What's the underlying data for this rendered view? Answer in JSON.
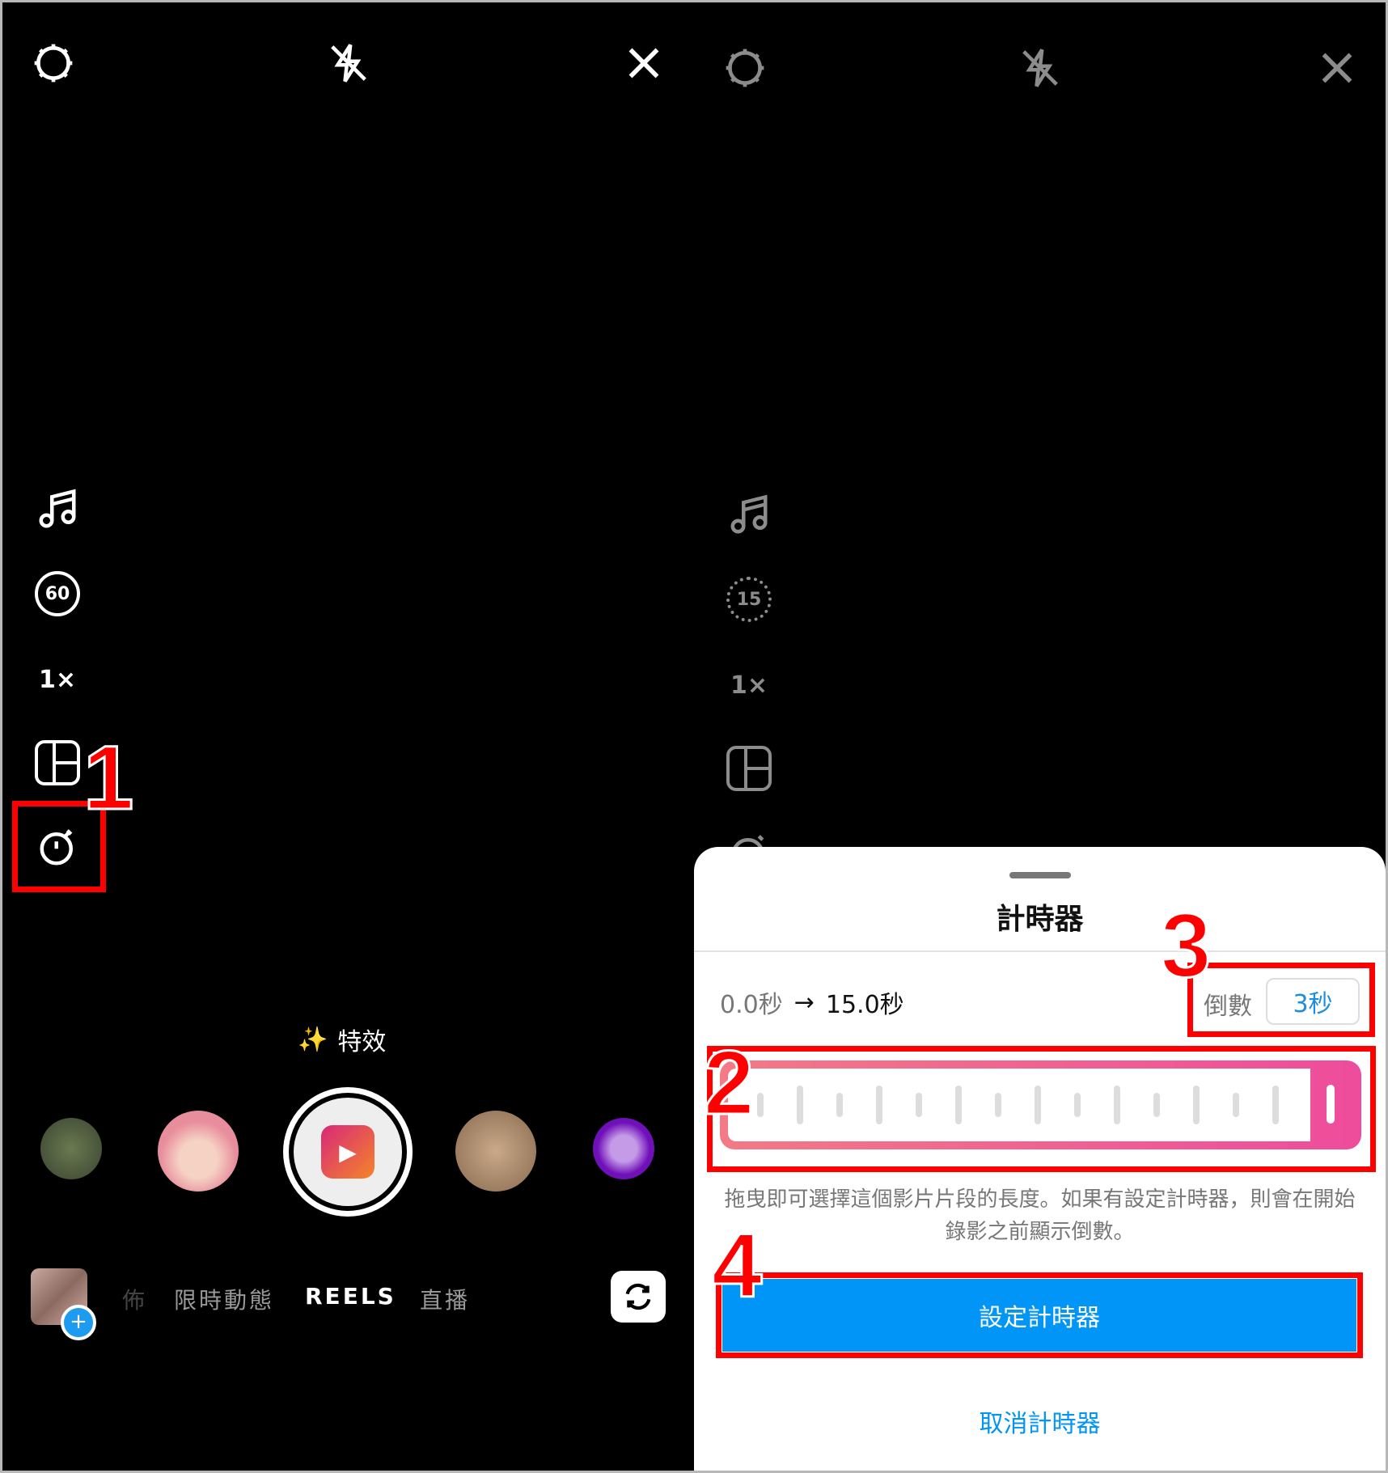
{
  "left_screen": {
    "top_icons": [
      "settings-gear-icon",
      "flash-off-icon",
      "close-icon"
    ],
    "side_tools": {
      "music": "music-note-icon",
      "length": "60",
      "speed": "1×",
      "layout": "layout-icon",
      "timer": "timer-icon"
    },
    "effects_label": "特效",
    "modes": [
      "佈",
      "限時動態",
      "REELS",
      "直播"
    ],
    "active_mode": "REELS"
  },
  "right_screen": {
    "side_tools": {
      "length": "15",
      "speed": "1×"
    },
    "sheet": {
      "title": "計時器",
      "range_start": "0.0秒",
      "arrow": "→",
      "range_end": "15.0秒",
      "countdown_label": "倒數",
      "countdown_value": "3秒",
      "slider_fraction": 1.0,
      "description_line1": "拖曳即可選擇這個影片片段的長度。如果有設定計時器，則會在開始",
      "description_line2": "錄影之前顯示倒數。",
      "set_button": "設定計時器",
      "cancel_button": "取消計時器"
    }
  },
  "annotations": {
    "n1": "1",
    "n2": "2",
    "n3": "3",
    "n4": "4"
  },
  "colors": {
    "accent_blue": "#0095f6",
    "annotation_red": "#ff0000",
    "slider_gradient_start": "#f37a86",
    "slider_gradient_end": "#ee4c9c"
  }
}
